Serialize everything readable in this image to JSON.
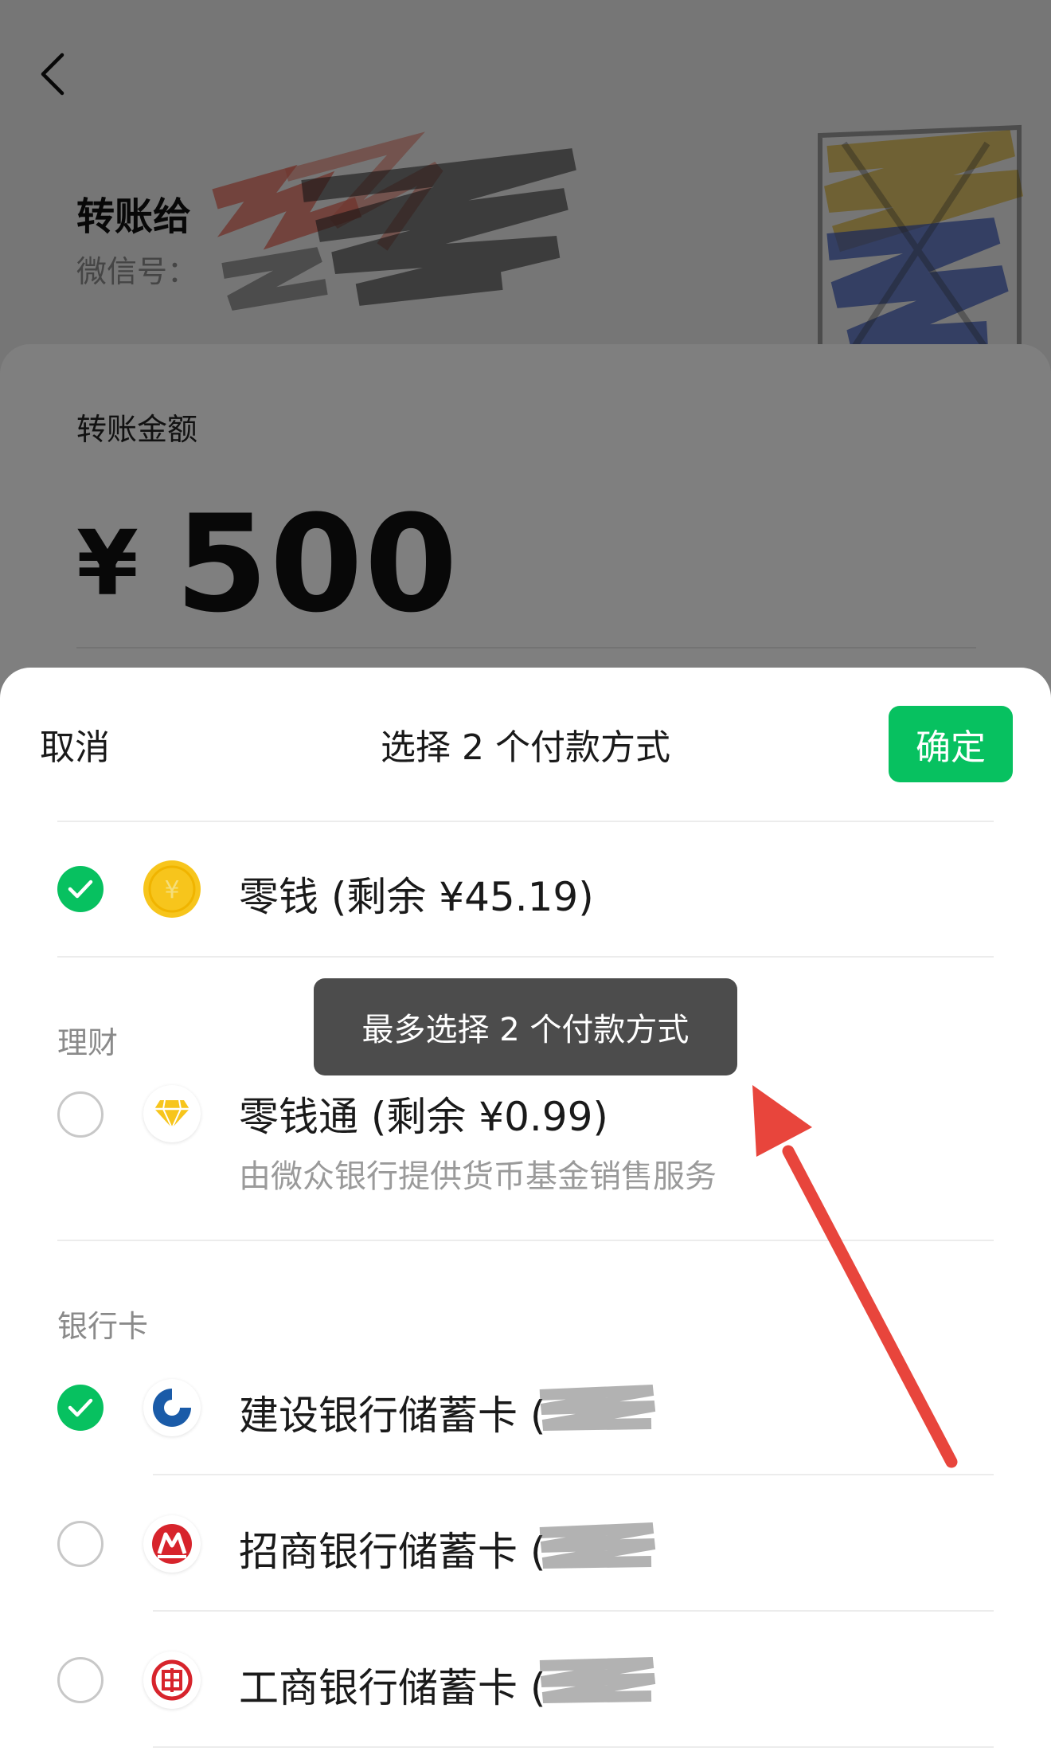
{
  "background": {
    "payee_title": "转账给",
    "payee_wxid_label": "微信号：",
    "amount_label": "转账金额",
    "amount_symbol": "¥",
    "amount_value": "500"
  },
  "sheet": {
    "cancel_label": "取消",
    "title": "选择 2 个付款方式",
    "confirm_label": "确定",
    "change": {
      "label": "零钱 (剩余 ¥45.19)",
      "checked": true,
      "icon": "yuan-coin-icon"
    },
    "licai": {
      "section_label": "理财",
      "label": "零钱通 (剩余 ¥0.99)",
      "subtitle": "由微众银行提供货币基金销售服务",
      "checked": false,
      "icon": "diamond-icon"
    },
    "bank_cards": {
      "section_label": "银行卡",
      "items": [
        {
          "label": "建设银行储蓄卡 (",
          "checked": true,
          "icon": "ccb-logo-icon"
        },
        {
          "label": "招商银行储蓄卡 (",
          "checked": false,
          "icon": "cmb-logo-icon"
        },
        {
          "label": "工商银行储蓄卡 (",
          "checked": false,
          "icon": "icbc-logo-icon"
        }
      ]
    }
  },
  "toast": {
    "text": "最多选择 2 个付款方式"
  },
  "colors": {
    "wechat_green": "#07c160",
    "coin_yellow": "#f7c51c",
    "arrow_red": "#e8453c",
    "ccb_blue": "#1a5ba8",
    "bank_red": "#d7242c"
  }
}
